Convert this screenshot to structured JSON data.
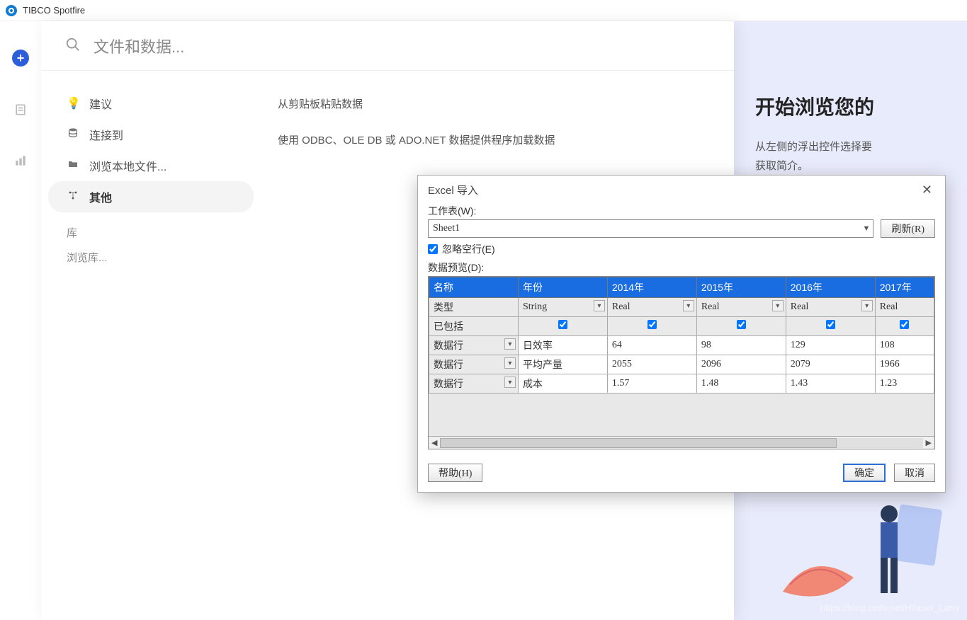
{
  "app": {
    "title": "TIBCO Spotfire"
  },
  "search": {
    "placeholder": "文件和数据..."
  },
  "nav": {
    "items": [
      {
        "icon": "💡",
        "label": "建议"
      },
      {
        "icon": "≡",
        "label": "连接到"
      },
      {
        "icon": "📁",
        "label": "浏览本地文件..."
      },
      {
        "icon": "•••",
        "label": "其他"
      }
    ],
    "lib_label": "库",
    "browse_lib": "浏览库..."
  },
  "content": {
    "line1": "从剪贴板粘贴数据",
    "line2": "使用 ODBC、OLE DB 或 ADO.NET 数据提供程序加载数据"
  },
  "right": {
    "heading": "开始浏览您的",
    "line1": "从左侧的浮出控件选择要",
    "line2": "获取简介。"
  },
  "dialog": {
    "title": "Excel 导入",
    "worksheet_label": "工作表(W):",
    "worksheet_value": "Sheet1",
    "refresh": "刷新(R)",
    "ignore_empty": "忽略空行(E)",
    "preview_label": "数据预览(D):",
    "headers": [
      "名称",
      "年份",
      "2014年",
      "2015年",
      "2016年",
      "2017年"
    ],
    "type_row_label": "类型",
    "types": [
      "String",
      "Real",
      "Real",
      "Real",
      "Real"
    ],
    "included_label": "已包括",
    "row_label": "数据行",
    "rows": [
      {
        "name": "日效率",
        "v": [
          "64",
          "98",
          "129",
          "108"
        ]
      },
      {
        "name": "平均产量",
        "v": [
          "2055",
          "2096",
          "2079",
          "1966"
        ]
      },
      {
        "name": "成本",
        "v": [
          "1.57",
          "1.48",
          "1.43",
          "1.23"
        ]
      }
    ],
    "help": "帮助(H)",
    "ok": "确定",
    "cancel": "取消"
  },
  "watermark": "https://blog.csdn.net/Hilaser_Larry",
  "chart_data": {
    "type": "table",
    "title": "Excel 导入 数据预览",
    "columns": [
      "年份",
      "2014年",
      "2015年",
      "2016年",
      "2017年"
    ],
    "column_types": [
      "String",
      "Real",
      "Real",
      "Real",
      "Real"
    ],
    "rows": [
      {
        "年份": "日效率",
        "2014年": 64,
        "2015年": 98,
        "2016年": 129,
        "2017年": 108
      },
      {
        "年份": "平均产量",
        "2014年": 2055,
        "2015年": 2096,
        "2016年": 2079,
        "2017年": 1966
      },
      {
        "年份": "成本",
        "2014年": 1.57,
        "2015年": 1.48,
        "2016年": 1.43,
        "2017年": 1.23
      }
    ]
  }
}
